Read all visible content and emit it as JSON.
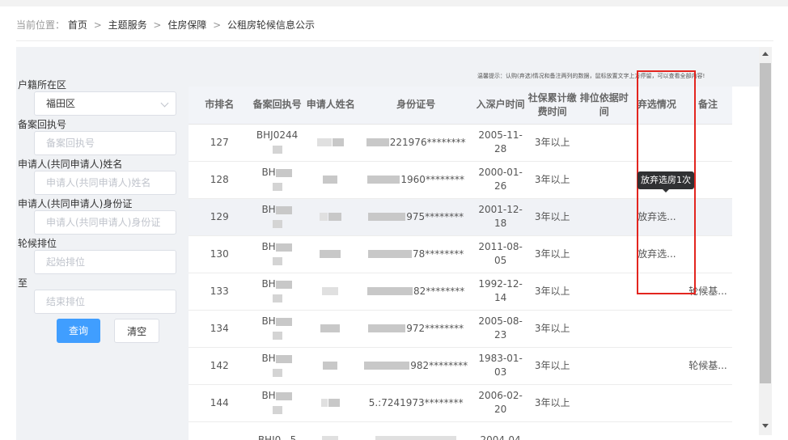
{
  "breadcrumb": {
    "prefix": "当前位置：",
    "items": [
      "首页",
      "主题服务",
      "住房保障",
      "公租房轮候信息公示"
    ],
    "separator": ">"
  },
  "form": {
    "district_label": "户籍所在区",
    "district_value": "福田区",
    "record_label": "备案回执号",
    "record_placeholder": "备案回执号",
    "applicant_name_label": "申请人(共同申请人)姓名",
    "applicant_name_placeholder": "申请人(共同申请人)姓名",
    "applicant_id_label": "申请人(共同申请人)身份证",
    "applicant_id_placeholder": "申请人(共同申请人)身份证",
    "rank_label": "轮候排位",
    "rank_start_placeholder": "起始排位",
    "to_label": "至",
    "rank_end_placeholder": "结束排位",
    "query_button": "查询",
    "clear_button": "清空"
  },
  "tip": "温馨提示：认购(弃选)情况和备注两列的数据，鼠标放置文字上方停留，可以查看全部内容!",
  "table": {
    "headers": [
      "市排名",
      "备案回执号",
      "申请人姓名",
      "身份证号",
      "入深户时间",
      "社保累计缴费时间",
      "排位依据时间",
      "弃选情况",
      "备注"
    ],
    "rows": [
      {
        "rank": "127",
        "record": "BHJ0244",
        "id_suffix": "221976********",
        "date": "2005-11-28",
        "social": "3年以上",
        "basis": "",
        "abandon": "",
        "note": ""
      },
      {
        "rank": "128",
        "record": "BH",
        "id_suffix": "1960********",
        "date": "2000-01-26",
        "social": "3年以上",
        "basis": "",
        "abandon": "",
        "note": ""
      },
      {
        "rank": "129",
        "record": "BH",
        "id_suffix": "975********",
        "date": "2001-12-18",
        "social": "3年以上",
        "basis": "",
        "abandon": "放弃选...",
        "note": ""
      },
      {
        "rank": "130",
        "record": "BH",
        "id_suffix": "78********",
        "date": "2011-08-05",
        "social": "3年以上",
        "basis": "",
        "abandon": "放弃选...",
        "note": ""
      },
      {
        "rank": "133",
        "record": "BH",
        "id_suffix": "82********",
        "date": "1992-12-14",
        "social": "3年以上",
        "basis": "",
        "abandon": "",
        "note": "轮候基..."
      },
      {
        "rank": "134",
        "record": "BH",
        "id_suffix": "972********",
        "date": "2005-08-23",
        "social": "3年以上",
        "basis": "",
        "abandon": "",
        "note": ""
      },
      {
        "rank": "142",
        "record": "BH",
        "id_suffix": "982********",
        "date": "1983-01-03",
        "social": "3年以上",
        "basis": "",
        "abandon": "",
        "note": "轮候基..."
      },
      {
        "rank": "144",
        "record": "BH",
        "id_suffix": "5.:7241973********",
        "date": "2006-02-20",
        "social": "3年以上",
        "basis": "",
        "abandon": "",
        "note": ""
      },
      {
        "rank": "",
        "record": "BHJ0...5",
        "id_suffix": "",
        "date": "2004-04",
        "social": "",
        "basis": "",
        "abandon": "",
        "note": ""
      }
    ]
  },
  "tooltip": "放弃选房1次",
  "colors": {
    "primary": "#409eff",
    "highlight": "#e3251f",
    "tooltip_bg": "#303133"
  }
}
